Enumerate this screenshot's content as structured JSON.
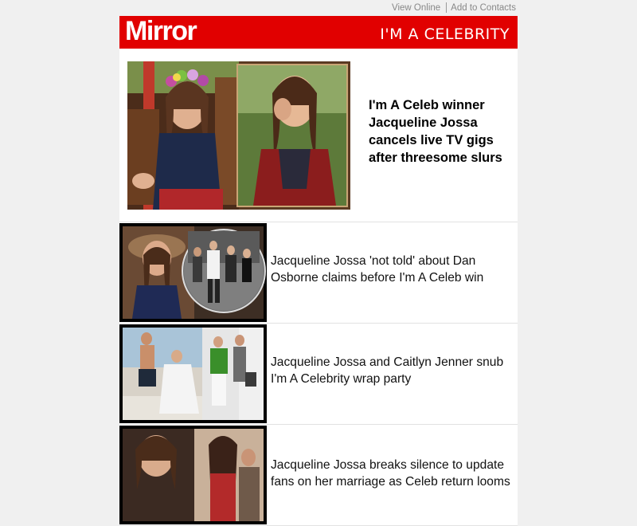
{
  "topbar": {
    "view_online": "View Online",
    "add_contacts": "Add to Contacts"
  },
  "header": {
    "logo": "Mirror",
    "section": "I'M A CELEBRITY",
    "brand_color": "#e10000"
  },
  "hero": {
    "title": "I'm A Celeb winner Jacqueline Jossa cancels live TV gigs after threesome slurs"
  },
  "articles": [
    {
      "title": "Jacqueline Jossa 'not told' about Dan Osborne claims before I'm A Celeb win"
    },
    {
      "title": "Jacqueline Jossa and Caitlyn Jenner snub I'm A Celebrity wrap party"
    },
    {
      "title": "Jacqueline Jossa breaks silence to update fans on her marriage as Celeb return looms"
    }
  ]
}
